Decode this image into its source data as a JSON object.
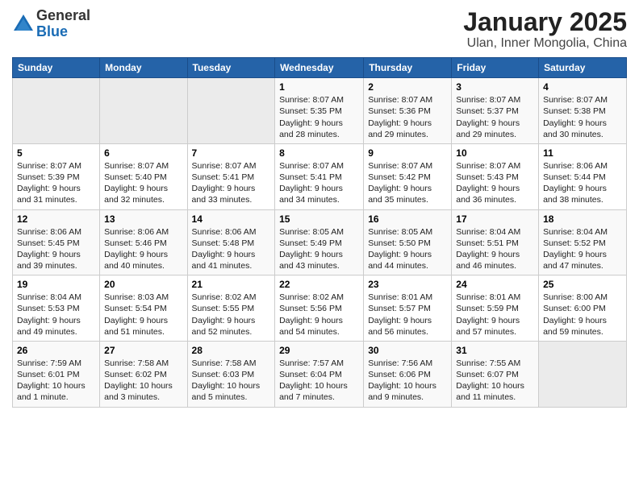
{
  "logo": {
    "general": "General",
    "blue": "Blue"
  },
  "title": "January 2025",
  "subtitle": "Ulan, Inner Mongolia, China",
  "days_of_week": [
    "Sunday",
    "Monday",
    "Tuesday",
    "Wednesday",
    "Thursday",
    "Friday",
    "Saturday"
  ],
  "weeks": [
    [
      {
        "day": "",
        "info": ""
      },
      {
        "day": "",
        "info": ""
      },
      {
        "day": "",
        "info": ""
      },
      {
        "day": "1",
        "info": "Sunrise: 8:07 AM\nSunset: 5:35 PM\nDaylight: 9 hours\nand 28 minutes."
      },
      {
        "day": "2",
        "info": "Sunrise: 8:07 AM\nSunset: 5:36 PM\nDaylight: 9 hours\nand 29 minutes."
      },
      {
        "day": "3",
        "info": "Sunrise: 8:07 AM\nSunset: 5:37 PM\nDaylight: 9 hours\nand 29 minutes."
      },
      {
        "day": "4",
        "info": "Sunrise: 8:07 AM\nSunset: 5:38 PM\nDaylight: 9 hours\nand 30 minutes."
      }
    ],
    [
      {
        "day": "5",
        "info": "Sunrise: 8:07 AM\nSunset: 5:39 PM\nDaylight: 9 hours\nand 31 minutes."
      },
      {
        "day": "6",
        "info": "Sunrise: 8:07 AM\nSunset: 5:40 PM\nDaylight: 9 hours\nand 32 minutes."
      },
      {
        "day": "7",
        "info": "Sunrise: 8:07 AM\nSunset: 5:41 PM\nDaylight: 9 hours\nand 33 minutes."
      },
      {
        "day": "8",
        "info": "Sunrise: 8:07 AM\nSunset: 5:41 PM\nDaylight: 9 hours\nand 34 minutes."
      },
      {
        "day": "9",
        "info": "Sunrise: 8:07 AM\nSunset: 5:42 PM\nDaylight: 9 hours\nand 35 minutes."
      },
      {
        "day": "10",
        "info": "Sunrise: 8:07 AM\nSunset: 5:43 PM\nDaylight: 9 hours\nand 36 minutes."
      },
      {
        "day": "11",
        "info": "Sunrise: 8:06 AM\nSunset: 5:44 PM\nDaylight: 9 hours\nand 38 minutes."
      }
    ],
    [
      {
        "day": "12",
        "info": "Sunrise: 8:06 AM\nSunset: 5:45 PM\nDaylight: 9 hours\nand 39 minutes."
      },
      {
        "day": "13",
        "info": "Sunrise: 8:06 AM\nSunset: 5:46 PM\nDaylight: 9 hours\nand 40 minutes."
      },
      {
        "day": "14",
        "info": "Sunrise: 8:06 AM\nSunset: 5:48 PM\nDaylight: 9 hours\nand 41 minutes."
      },
      {
        "day": "15",
        "info": "Sunrise: 8:05 AM\nSunset: 5:49 PM\nDaylight: 9 hours\nand 43 minutes."
      },
      {
        "day": "16",
        "info": "Sunrise: 8:05 AM\nSunset: 5:50 PM\nDaylight: 9 hours\nand 44 minutes."
      },
      {
        "day": "17",
        "info": "Sunrise: 8:04 AM\nSunset: 5:51 PM\nDaylight: 9 hours\nand 46 minutes."
      },
      {
        "day": "18",
        "info": "Sunrise: 8:04 AM\nSunset: 5:52 PM\nDaylight: 9 hours\nand 47 minutes."
      }
    ],
    [
      {
        "day": "19",
        "info": "Sunrise: 8:04 AM\nSunset: 5:53 PM\nDaylight: 9 hours\nand 49 minutes."
      },
      {
        "day": "20",
        "info": "Sunrise: 8:03 AM\nSunset: 5:54 PM\nDaylight: 9 hours\nand 51 minutes."
      },
      {
        "day": "21",
        "info": "Sunrise: 8:02 AM\nSunset: 5:55 PM\nDaylight: 9 hours\nand 52 minutes."
      },
      {
        "day": "22",
        "info": "Sunrise: 8:02 AM\nSunset: 5:56 PM\nDaylight: 9 hours\nand 54 minutes."
      },
      {
        "day": "23",
        "info": "Sunrise: 8:01 AM\nSunset: 5:57 PM\nDaylight: 9 hours\nand 56 minutes."
      },
      {
        "day": "24",
        "info": "Sunrise: 8:01 AM\nSunset: 5:59 PM\nDaylight: 9 hours\nand 57 minutes."
      },
      {
        "day": "25",
        "info": "Sunrise: 8:00 AM\nSunset: 6:00 PM\nDaylight: 9 hours\nand 59 minutes."
      }
    ],
    [
      {
        "day": "26",
        "info": "Sunrise: 7:59 AM\nSunset: 6:01 PM\nDaylight: 10 hours\nand 1 minute."
      },
      {
        "day": "27",
        "info": "Sunrise: 7:58 AM\nSunset: 6:02 PM\nDaylight: 10 hours\nand 3 minutes."
      },
      {
        "day": "28",
        "info": "Sunrise: 7:58 AM\nSunset: 6:03 PM\nDaylight: 10 hours\nand 5 minutes."
      },
      {
        "day": "29",
        "info": "Sunrise: 7:57 AM\nSunset: 6:04 PM\nDaylight: 10 hours\nand 7 minutes."
      },
      {
        "day": "30",
        "info": "Sunrise: 7:56 AM\nSunset: 6:06 PM\nDaylight: 10 hours\nand 9 minutes."
      },
      {
        "day": "31",
        "info": "Sunrise: 7:55 AM\nSunset: 6:07 PM\nDaylight: 10 hours\nand 11 minutes."
      },
      {
        "day": "",
        "info": ""
      }
    ]
  ]
}
